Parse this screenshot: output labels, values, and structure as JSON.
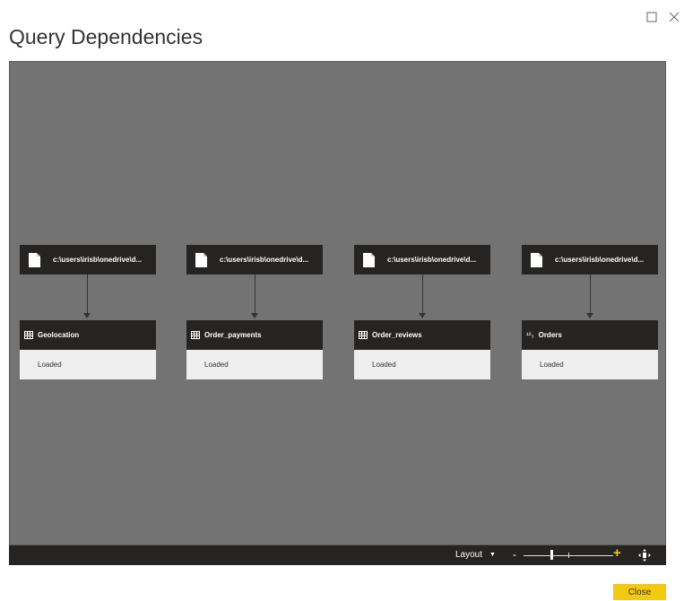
{
  "dialog": {
    "title": "Query Dependencies",
    "close_label": "Close"
  },
  "nodes": [
    {
      "source_label": "c:\\users\\irisb\\onedrive\\d...",
      "query_name": "Geolocation",
      "query_icon": "table-icon",
      "status": "Loaded"
    },
    {
      "source_label": "c:\\users\\irisb\\onedrive\\d...",
      "query_name": "Order_payments",
      "query_icon": "table-icon",
      "status": "Loaded"
    },
    {
      "source_label": "c:\\users\\irisb\\onedrive\\d...",
      "query_name": "Order_reviews",
      "query_icon": "table-icon",
      "status": "Loaded"
    },
    {
      "source_label": "c:\\users\\irisb\\onedrive\\d...",
      "query_name": "Orders",
      "query_icon": "number-type-icon",
      "query_icon_text": "¹²₃",
      "status": "Loaded"
    }
  ],
  "toolbar": {
    "layout_label": "Layout",
    "zoom_minus": "-",
    "zoom_plus": "+"
  },
  "colors": {
    "canvas": "#737373",
    "node_header": "#252423",
    "node_body": "#efefef",
    "accent": "#f2c811"
  }
}
